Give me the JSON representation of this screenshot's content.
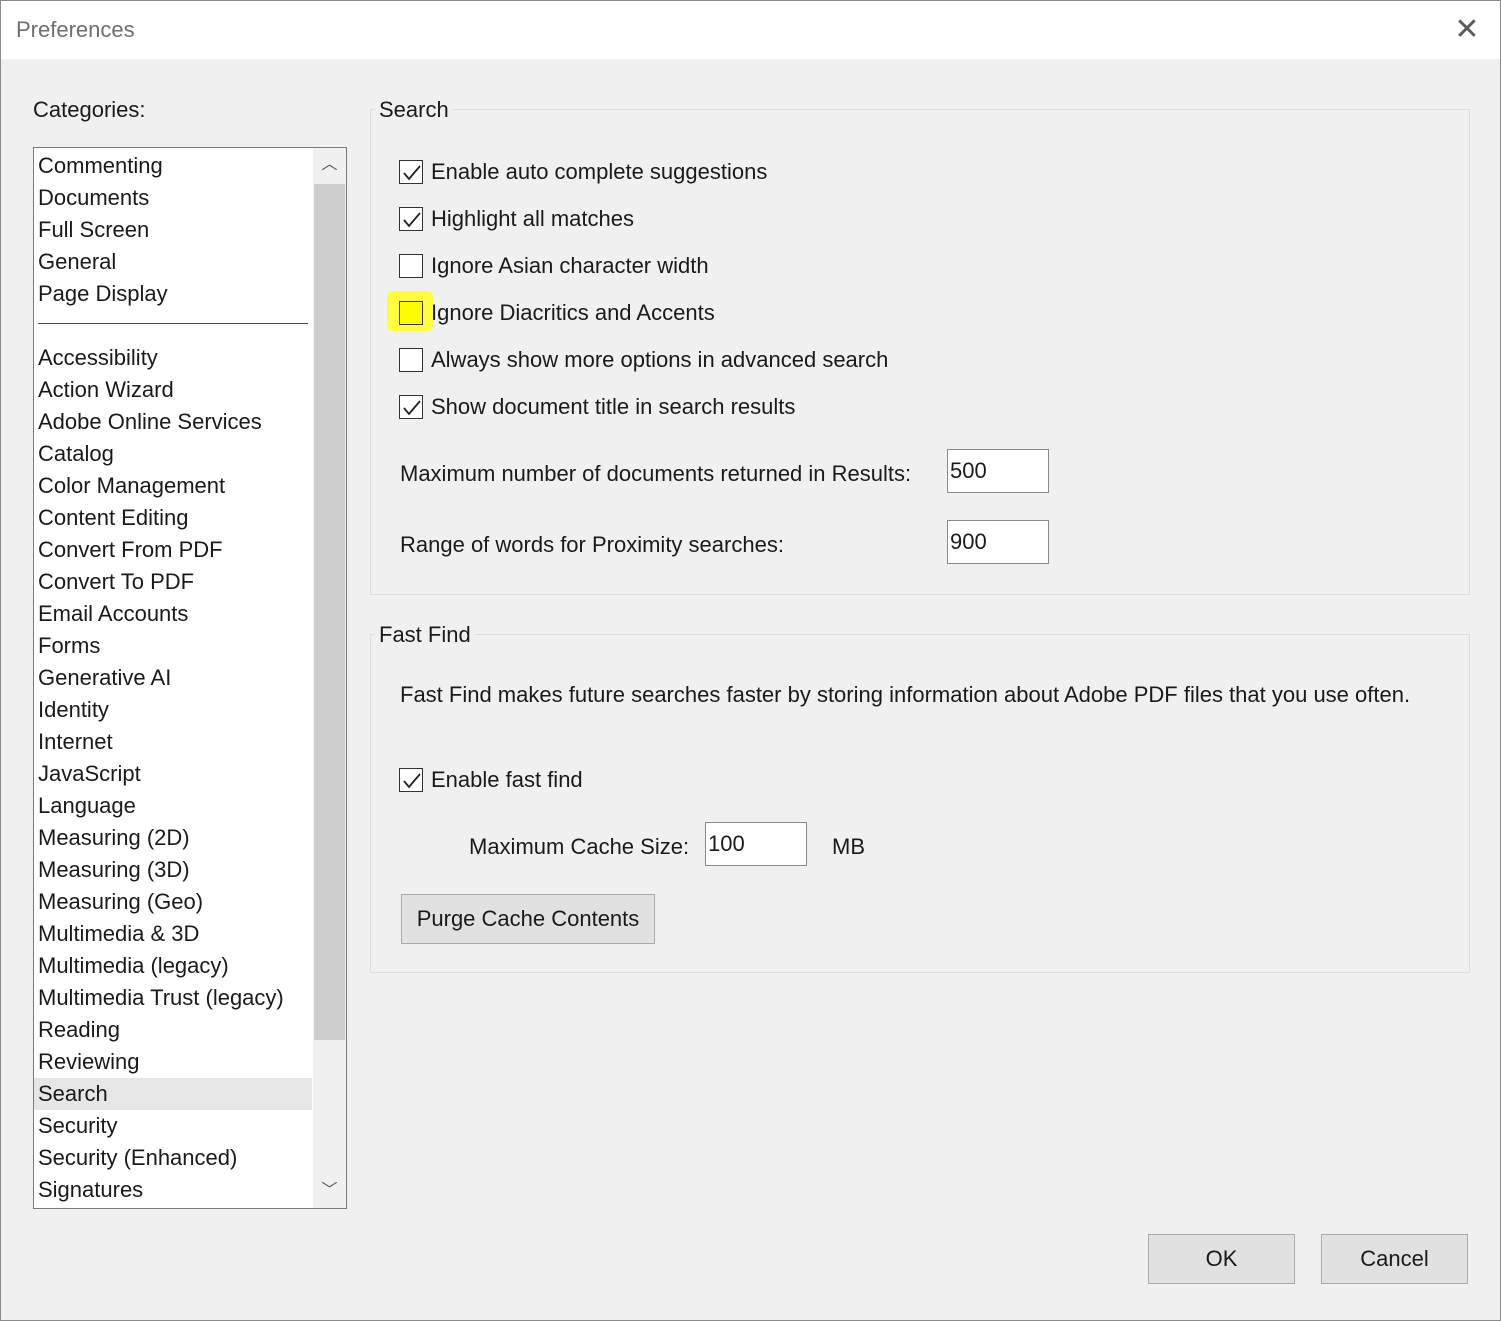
{
  "window": {
    "title": "Preferences"
  },
  "categories": {
    "label": "Categories:",
    "top_items": [
      "Commenting",
      "Documents",
      "Full Screen",
      "General",
      "Page Display"
    ],
    "items": [
      "Accessibility",
      "Action Wizard",
      "Adobe Online Services",
      "Catalog",
      "Color Management",
      "Content Editing",
      "Convert From PDF",
      "Convert To PDF",
      "Email Accounts",
      "Forms",
      "Generative AI",
      "Identity",
      "Internet",
      "JavaScript",
      "Language",
      "Measuring (2D)",
      "Measuring (3D)",
      "Measuring (Geo)",
      "Multimedia & 3D",
      "Multimedia (legacy)",
      "Multimedia Trust (legacy)",
      "Reading",
      "Reviewing",
      "Search",
      "Security",
      "Security (Enhanced)",
      "Signatures"
    ],
    "selected": "Search"
  },
  "search": {
    "group_title": "Search",
    "options": [
      {
        "label": "Enable auto complete suggestions",
        "checked": true
      },
      {
        "label": "Highlight all matches",
        "checked": true
      },
      {
        "label": "Ignore Asian character width",
        "checked": false
      },
      {
        "label": "Ignore Diacritics and Accents",
        "checked": false
      },
      {
        "label": "Always show more options in advanced search",
        "checked": false
      },
      {
        "label": "Show document title in search results",
        "checked": true
      }
    ],
    "max_docs_label": "Maximum number of documents returned in Results:",
    "max_docs_value": "500",
    "proximity_label": "Range of words for Proximity searches:",
    "proximity_value": "900"
  },
  "fast_find": {
    "group_title": "Fast Find",
    "description": "Fast Find makes future searches faster by storing information about Adobe PDF files that you use often.",
    "enable_label": "Enable fast find",
    "enable_checked": true,
    "cache_label": "Maximum Cache Size:",
    "cache_value": "100",
    "cache_unit": "MB",
    "purge_label": "Purge Cache Contents"
  },
  "footer": {
    "ok_label": "OK",
    "cancel_label": "Cancel"
  },
  "highlight_color": "#fffe00"
}
